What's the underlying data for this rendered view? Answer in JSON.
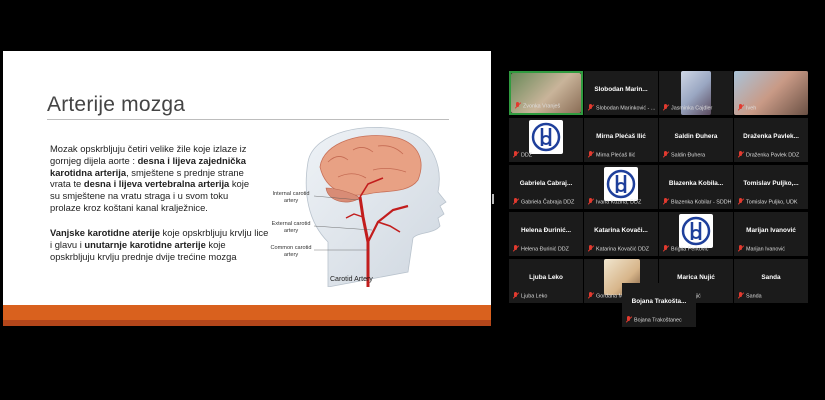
{
  "slide": {
    "title": "Arterije mozga",
    "p1": {
      "a": "Mozak opskrbljuju četiri velike žile koje izlaze iz gornjeg dijela aorte : ",
      "b": "desna i lijeva zajednička karotidna arterija",
      "c": ", smještene s prednje strane vrata te ",
      "d": "desna i lijeva vertebralna arterija",
      "e": " koje su smještene na vratu straga i u svom toku prolaze kroz koštani kanal kralježnice."
    },
    "p2": {
      "a": "Vanjske karotidne aterije",
      "b": " koje opskrbljuju krvlju lice i glavu i ",
      "c": "unutarnje karotidne arterije",
      "d": " koje opskrbljuju krvlju prednje dvije trećine mozga"
    },
    "figure": {
      "internal": "Internal carotid artery",
      "external": "External carotid artery",
      "common": "Common carotid artery",
      "caption": "Carotid Artery"
    }
  },
  "colors": {
    "accent_bar": "#d9611e",
    "active_speaker": "#2f9b3f",
    "muted_mic": "#e23a2f"
  },
  "participants": [
    {
      "name": "",
      "label": "Zvonka Vranješ",
      "video": true,
      "active": true
    },
    {
      "name": "Slobodan  Marin...",
      "label": "Slobodan Marinković - ...",
      "video": false
    },
    {
      "name": "",
      "label": "Jasminka Cajdler",
      "video": true
    },
    {
      "name": "",
      "label": "Iveh",
      "video": true
    },
    {
      "name": "",
      "label": "DDZ",
      "logo": true
    },
    {
      "name": "Mirna Plećaš Ilić",
      "label": "Mirna Plećaš Ilić"
    },
    {
      "name": "Saldin Đuhera",
      "label": "Saldin Đuhera"
    },
    {
      "name": "Draženka  Pavlek...",
      "label": "Draženka Pavlek DDZ"
    },
    {
      "name": "Gabriela  Čabraj...",
      "label": "Gabriela Čabraja DDZ"
    },
    {
      "name": "",
      "label": "Ivana Kuzina, DDZ",
      "logo": true
    },
    {
      "name": "Blazenka  Kobila...",
      "label": "Blazenka Kobilar - SDDH"
    },
    {
      "name": "Tomislav  Puljko,...",
      "label": "Tomislav Puljko, UDK"
    },
    {
      "name": "Helena  Đurinić...",
      "label": "Helena Đurinić DDZ"
    },
    {
      "name": "Katarina  Kovači...",
      "label": "Katarina Kovačić DDZ"
    },
    {
      "name": "",
      "label": "Brigita Perković",
      "logo": true
    },
    {
      "name": "Marijan Ivanović",
      "label": "Marijan Ivanović"
    },
    {
      "name": "Ljuba Leko",
      "label": "Ljuba Leko"
    },
    {
      "name": "",
      "label": "Gordana Mohar",
      "video": true
    },
    {
      "name": "Marica Nujić",
      "label": "Marica Nujić"
    },
    {
      "name": "Sanda",
      "label": "Sanda"
    },
    {
      "name": "Bojana  Trakošta...",
      "label": "Bojana Trakoštanec"
    }
  ]
}
